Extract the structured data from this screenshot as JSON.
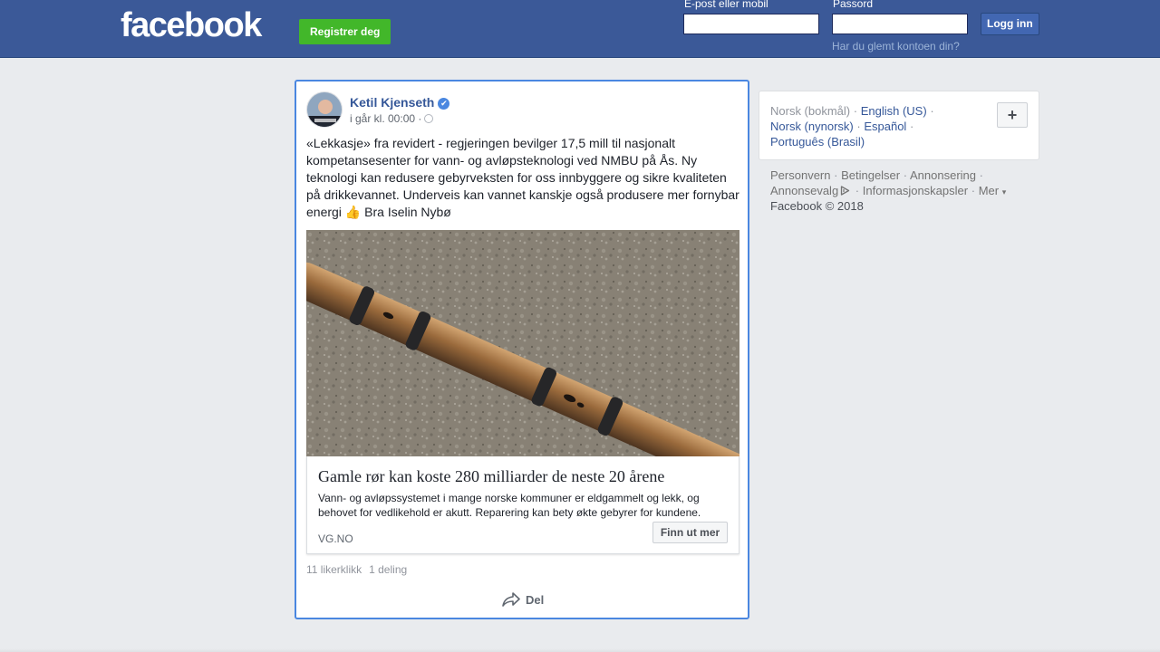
{
  "header": {
    "logo": "facebook",
    "register_label": "Registrer deg",
    "email_label": "E-post eller mobil",
    "email_value": "",
    "password_label": "Passord",
    "password_value": "",
    "login_label": "Logg inn",
    "forgot_label": "Har du glemt kontoen din?"
  },
  "post": {
    "author": "Ketil Kjenseth",
    "verified_icon": "✔",
    "timestamp": "i går kl. 00:00 ·",
    "text": "«Lekkasje» fra revidert - regjeringen bevilger 17,5 mill til nasjonalt kompetansesenter for vann- og avløpsteknologi ved NMBU på Ås. Ny teknologi kan redusere gebyrveksten for oss innbyggere og sikre kvaliteten på drikkevannet. Underveis kan vannet kanskje også produsere mer fornybar energi",
    "emoji": "👍",
    "text_tail": "Bra Iselin Nybø",
    "link": {
      "title": "Gamle rør kan koste 280 milliarder de neste 20 årene",
      "description": "Vann- og avløpssystemet i mange norske kommuner er eldgammelt og lekk, og behovet for vedlikehold er akutt. Reparering kan bety økte gebyrer for kundene.",
      "domain": "VG.NO",
      "cta_label": "Finn ut mer"
    },
    "likes": "11 likerklikk",
    "shares": "1 deling",
    "share_label": "Del"
  },
  "sidebar": {
    "languages": [
      {
        "label": "Norsk (bokmål)",
        "current": true
      },
      {
        "label": "English (US)",
        "current": false
      },
      {
        "label": "Norsk (nynorsk)",
        "current": false
      },
      {
        "label": "Español",
        "current": false
      },
      {
        "label": "Português (Brasil)",
        "current": false
      }
    ],
    "separator": "·",
    "add_label": "+",
    "footer_links": [
      "Personvern",
      "Betingelser",
      "Annonsering",
      "Annonsevalg",
      "Informasjonskapsler",
      "Mer"
    ],
    "more_caret": "▾",
    "copyright": "Facebook © 2018"
  },
  "colors": {
    "brand": "#3b5998",
    "register": "#42b72a",
    "link": "#365899",
    "highlight_border": "#4a87e0"
  }
}
